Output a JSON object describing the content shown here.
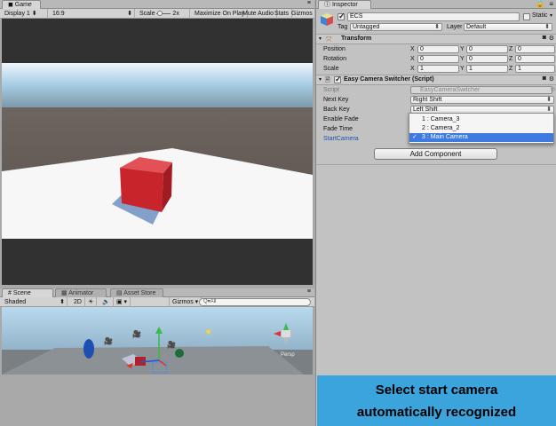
{
  "game": {
    "tab_label": "Game",
    "display": "Display 1",
    "aspect": "16:9",
    "scale_label": "Scale",
    "scale_value": "2x",
    "maximize": "Maximize On Play",
    "mute": "Mute Audio",
    "stats": "Stats",
    "gizmos": "Gizmos"
  },
  "scene": {
    "tabs": [
      {
        "label": "Scene"
      },
      {
        "label": "Animator"
      },
      {
        "label": "Asset Store"
      }
    ],
    "shading": "Shaded",
    "mode_2d": "2D",
    "gizmos": "Gizmos",
    "search_placeholder": "Q▾All",
    "persp_label": "Persp"
  },
  "inspector": {
    "tab_label": "Inspector",
    "object_name": "ECS",
    "static_label": "Static",
    "tag_label": "Tag",
    "tag_value": "Untagged",
    "layer_label": "Layer",
    "layer_value": "Default",
    "transform": {
      "title": "Transform",
      "rows": [
        {
          "label": "Position",
          "x": "0",
          "y": "0",
          "z": "0"
        },
        {
          "label": "Rotation",
          "x": "0",
          "y": "0",
          "z": "0"
        },
        {
          "label": "Scale",
          "x": "1",
          "y": "1",
          "z": "1"
        }
      ]
    },
    "script": {
      "title": "Easy Camera Switcher (Script)",
      "script_label": "Script",
      "script_value": "EasyCameraSwitcher",
      "next_key_label": "Next Key",
      "next_key_value": "Right Shift",
      "back_key_label": "Back Key",
      "back_key_value": "Left Shift",
      "enable_fade_label": "Enable Fade",
      "fade_time_label": "Fade Time",
      "start_camera_label": "StartCamera"
    },
    "popup_options": [
      {
        "label": "1 : Camera_3",
        "selected": false
      },
      {
        "label": "2 : Camera_2",
        "selected": false
      },
      {
        "label": "3 : Main Camera",
        "selected": true
      }
    ],
    "add_component": "Add Component"
  },
  "banner": {
    "line1": "Select start camera",
    "line2": "automatically recognized"
  },
  "colors": {
    "banner": "#3ba4dc",
    "selection": "#3e7ae0",
    "cube": "#c8242c"
  }
}
